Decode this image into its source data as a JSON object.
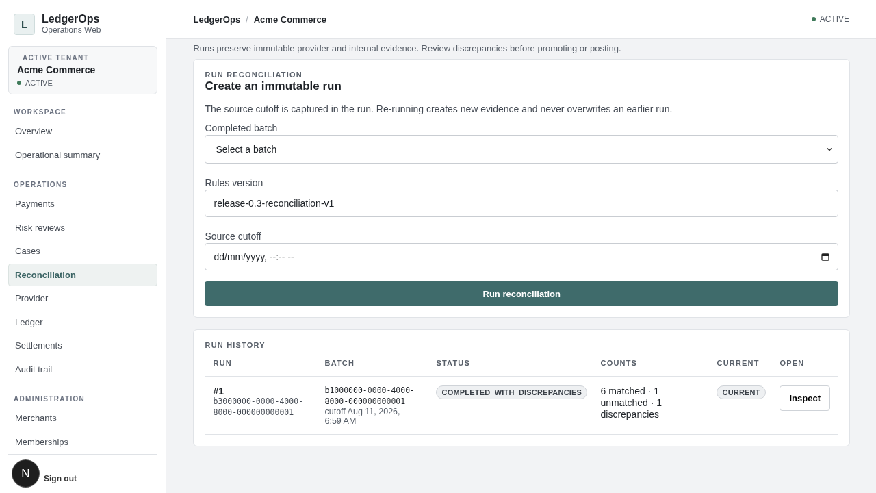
{
  "brand": {
    "logo_letter": "L",
    "name": "LedgerOps",
    "subtitle": "Operations Web"
  },
  "tenant": {
    "label": "ACTIVE TENANT",
    "name": "Acme Commerce",
    "status": "ACTIVE"
  },
  "sidebar": {
    "sections": [
      {
        "title": "WORKSPACE",
        "items": [
          {
            "label": "Overview",
            "selected": false
          },
          {
            "label": "Operational summary",
            "selected": false
          }
        ]
      },
      {
        "title": "OPERATIONS",
        "items": [
          {
            "label": "Payments",
            "selected": false
          },
          {
            "label": "Risk reviews",
            "selected": false
          },
          {
            "label": "Cases",
            "selected": false
          },
          {
            "label": "Reconciliation",
            "selected": true
          },
          {
            "label": "Provider",
            "selected": false
          },
          {
            "label": "Ledger",
            "selected": false
          },
          {
            "label": "Settlements",
            "selected": false
          },
          {
            "label": "Audit trail",
            "selected": false
          }
        ]
      },
      {
        "title": "ADMINISTRATION",
        "items": [
          {
            "label": "Merchants",
            "selected": false
          },
          {
            "label": "Memberships",
            "selected": false
          }
        ]
      }
    ],
    "sign_out": "Sign out",
    "dev_badge": "N"
  },
  "header": {
    "breadcrumb": [
      "LedgerOps",
      "Acme Commerce"
    ],
    "separator": "/",
    "status": "ACTIVE"
  },
  "intro": "Runs preserve immutable provider and internal evidence. Review discrepancies before promoting or posting.",
  "run_form": {
    "eyebrow": "RUN RECONCILIATION",
    "title": "Create an immutable run",
    "description": "The source cutoff is captured in the run. Re-running creates new evidence and never overwrites an earlier run.",
    "fields": [
      {
        "kind": "select",
        "label": "Completed batch",
        "value": "Select a batch"
      },
      {
        "kind": "text",
        "label": "Rules version",
        "value": "release-0.3-reconciliation-v1"
      },
      {
        "kind": "datetime",
        "label": "Source cutoff",
        "value": "dd/mm/yyyy, --:-- --"
      }
    ],
    "submit": "Run reconciliation"
  },
  "run_history": {
    "title": "RUN HISTORY",
    "columns": [
      "RUN",
      "BATCH",
      "STATUS",
      "COUNTS",
      "CURRENT",
      "OPEN"
    ],
    "rows": [
      {
        "run": "#1",
        "run_id": "b3000000-0000-4000-8000-000000000001",
        "batch_id": "b1000000-0000-4000-8000-000000000001",
        "cutoff": "cutoff Aug 11, 2026, 6:59 AM",
        "status": "COMPLETED_WITH_DISCREPANCIES",
        "counts": "6 matched · 1 unmatched · 1 discrepancies",
        "current": "CURRENT",
        "action": "Inspect"
      }
    ]
  }
}
